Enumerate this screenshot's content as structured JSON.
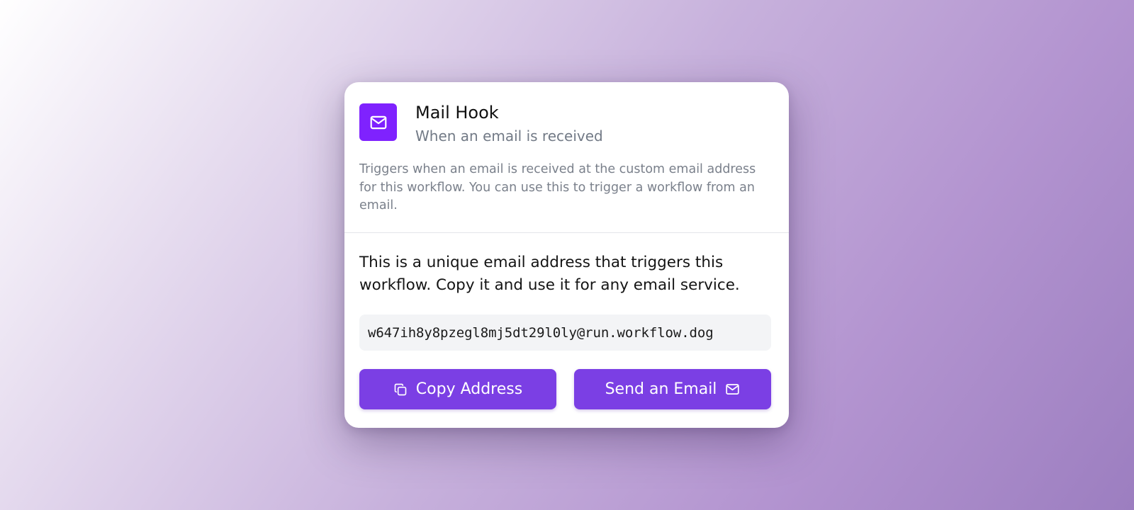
{
  "header": {
    "title": "Mail Hook",
    "subtitle": "When an email is received",
    "icon": "mail-icon"
  },
  "description": "Triggers when an email is received at the custom email address for this workflow. You can use this to trigger a workflow from an email.",
  "info": "This is a unique email address that triggers this workflow. Copy it and use it for any email service.",
  "address": "w647ih8y8pzegl8mj5dt29l0ly@run.workflow.dog",
  "buttons": {
    "copy": {
      "label": "Copy Address",
      "icon": "copy-icon"
    },
    "send": {
      "label": "Send an Email",
      "icon": "mail-icon"
    }
  },
  "colors": {
    "accent": "#7f22fe",
    "button": "#7b3fe4",
    "address_bg": "#f3f4f6"
  }
}
